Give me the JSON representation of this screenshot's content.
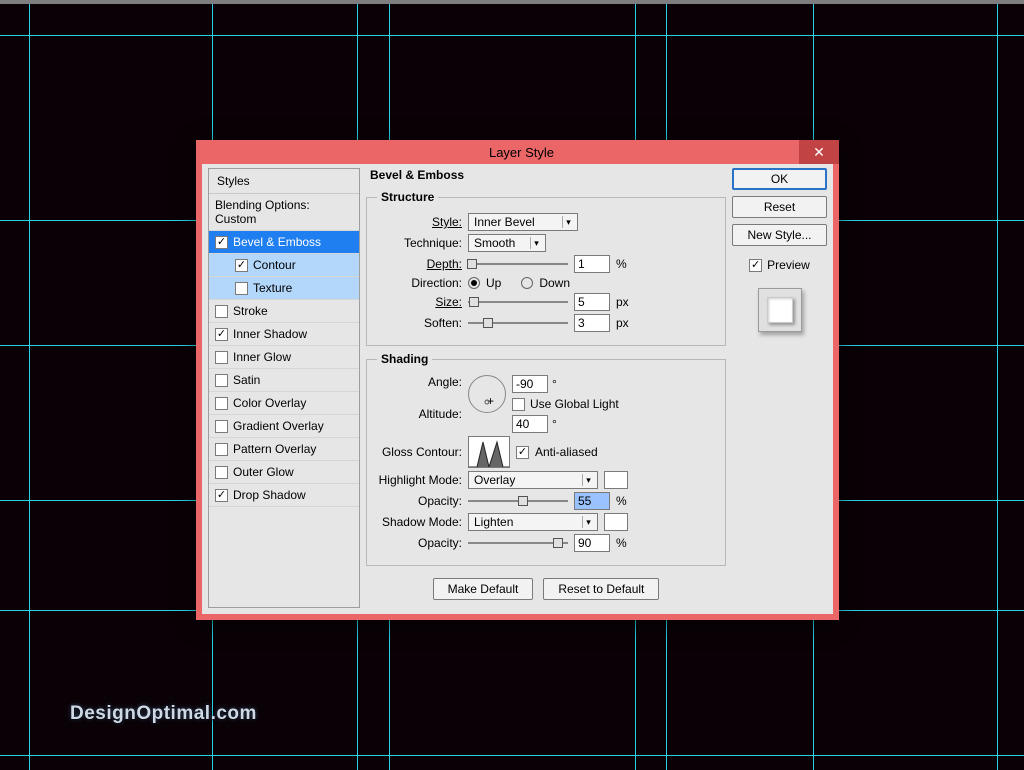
{
  "dialog": {
    "title": "Layer Style",
    "panel_title": "Bevel & Emboss"
  },
  "sidebar": {
    "header": "Styles",
    "blending": "Blending Options: Custom",
    "items": [
      {
        "label": "Bevel & Emboss",
        "checked": true,
        "selected": true
      },
      {
        "label": "Contour",
        "checked": true,
        "sub": true
      },
      {
        "label": "Texture",
        "checked": false,
        "sub": true
      },
      {
        "label": "Stroke",
        "checked": false
      },
      {
        "label": "Inner Shadow",
        "checked": true
      },
      {
        "label": "Inner Glow",
        "checked": false
      },
      {
        "label": "Satin",
        "checked": false
      },
      {
        "label": "Color Overlay",
        "checked": false
      },
      {
        "label": "Gradient Overlay",
        "checked": false
      },
      {
        "label": "Pattern Overlay",
        "checked": false
      },
      {
        "label": "Outer Glow",
        "checked": false
      },
      {
        "label": "Drop Shadow",
        "checked": true
      }
    ]
  },
  "structure": {
    "legend": "Structure",
    "style_label": "Style:",
    "style_value": "Inner Bevel",
    "technique_label": "Technique:",
    "technique_value": "Smooth",
    "depth_label": "Depth:",
    "depth_value": "1",
    "depth_unit": "%",
    "direction_label": "Direction:",
    "up": "Up",
    "down": "Down",
    "size_label": "Size:",
    "size_value": "5",
    "size_unit": "px",
    "soften_label": "Soften:",
    "soften_value": "3",
    "soften_unit": "px"
  },
  "shading": {
    "legend": "Shading",
    "angle_label": "Angle:",
    "angle_value": "-90",
    "angle_unit": "°",
    "global_label": "Use Global Light",
    "altitude_label": "Altitude:",
    "altitude_value": "40",
    "altitude_unit": "°",
    "gloss_label": "Gloss Contour:",
    "anti_label": "Anti-aliased",
    "highlight_mode_label": "Highlight Mode:",
    "highlight_mode_value": "Overlay",
    "highlight_opacity_label": "Opacity:",
    "highlight_opacity_value": "55",
    "highlight_opacity_unit": "%",
    "shadow_mode_label": "Shadow Mode:",
    "shadow_mode_value": "Lighten",
    "shadow_opacity_label": "Opacity:",
    "shadow_opacity_value": "90",
    "shadow_opacity_unit": "%"
  },
  "buttons": {
    "make_default": "Make Default",
    "reset_default": "Reset to Default",
    "ok": "OK",
    "reset": "Reset",
    "new_style": "New Style...",
    "preview": "Preview"
  },
  "watermark": "DesignOptimal.com"
}
